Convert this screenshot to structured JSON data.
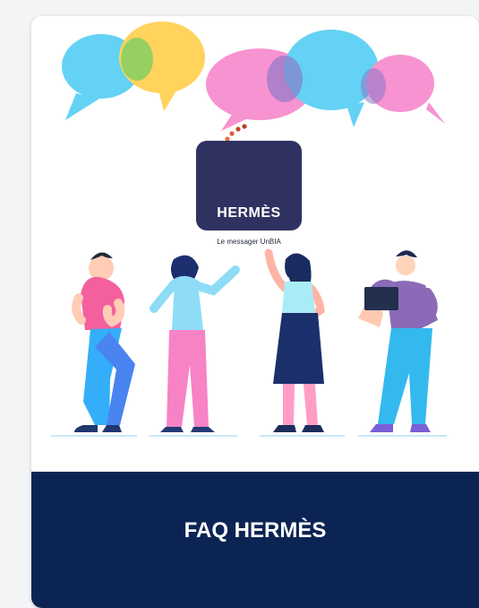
{
  "card": {
    "logo_title": "HERMÈS",
    "logo_tagline": "Le messager UnBIA",
    "footer_title": "FAQ HERMÈS"
  },
  "colors": {
    "footer_background": "#0c2454",
    "logo_background": "#2f3261",
    "bubble_blue": "#64d2f4",
    "bubble_yellow": "#ffd35c",
    "bubble_pink": "#f793d0",
    "bubble_purple": "#8b77c8",
    "bubble_green": "#8bcf63"
  },
  "icons": {
    "hero": "speech-bubbles-illustration",
    "logo": "hermes-logo"
  }
}
